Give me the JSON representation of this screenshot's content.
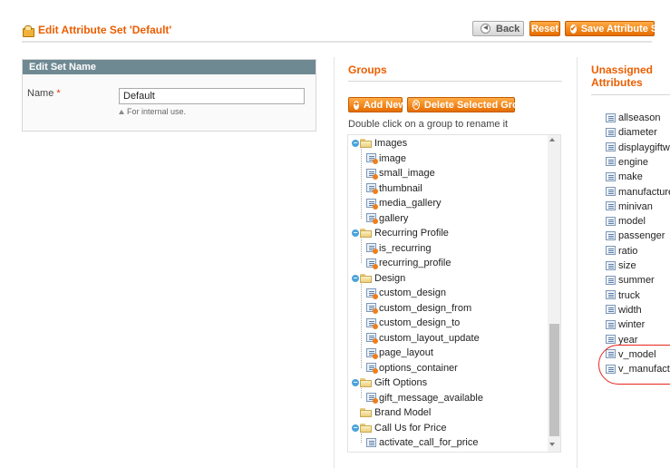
{
  "header": {
    "title": "Edit Attribute Set 'Default'",
    "buttons": {
      "back": "Back",
      "reset": "Reset",
      "save": "Save Attribute Set"
    }
  },
  "edit_set": {
    "heading": "Edit Set Name",
    "name_label": "Name",
    "required_mark": "*",
    "name_value": "Default",
    "note": "For internal use."
  },
  "groups": {
    "title": "Groups",
    "add_button": "Add New",
    "delete_button": "Delete Selected Group",
    "hint": "Double click on a group to rename it",
    "tree": [
      {
        "label": "Images",
        "children": [
          "image",
          "small_image",
          "thumbnail",
          "media_gallery",
          "gallery"
        ]
      },
      {
        "label": "Recurring Profile",
        "children": [
          "is_recurring",
          "recurring_profile"
        ]
      },
      {
        "label": "Design",
        "children": [
          "custom_design",
          "custom_design_from",
          "custom_design_to",
          "custom_layout_update",
          "page_layout",
          "options_container"
        ]
      },
      {
        "label": "Gift Options",
        "children": [
          "gift_message_available"
        ]
      },
      {
        "label": "Brand Model",
        "children": []
      },
      {
        "label": "Call Us for Price",
        "children": [
          "activate_call_for_price"
        ]
      }
    ]
  },
  "unassigned": {
    "title_line1": "Unassigned",
    "title_line2": "Attributes",
    "items": [
      "allseason",
      "diameter",
      "displaygiftwrap",
      "engine",
      "make",
      "manufacture",
      "minivan",
      "model",
      "passenger",
      "ratio",
      "size",
      "summer",
      "truck",
      "width",
      "winter",
      "year",
      "v_model",
      "v_manufacturer"
    ]
  },
  "colors": {
    "accent": "#eb5e00",
    "section_header": "#6f8992",
    "highlight_oval": "#e8261b"
  }
}
